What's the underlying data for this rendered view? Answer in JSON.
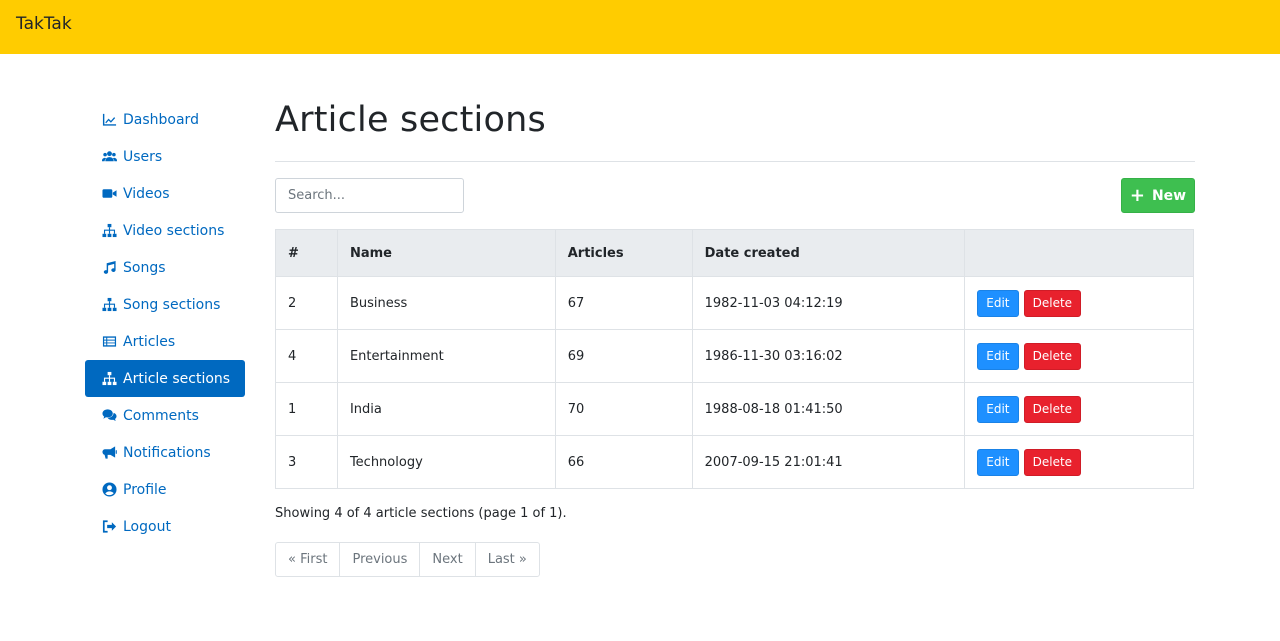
{
  "header": {
    "brand": "TakTak",
    "bg_color": "#ffcc00"
  },
  "sidebar": {
    "items": [
      {
        "label": "Dashboard",
        "icon": "chart-line-icon",
        "active": false
      },
      {
        "label": "Users",
        "icon": "users-icon",
        "active": false
      },
      {
        "label": "Videos",
        "icon": "video-icon",
        "active": false
      },
      {
        "label": "Video sections",
        "icon": "sitemap-icon",
        "active": false
      },
      {
        "label": "Songs",
        "icon": "music-icon",
        "active": false
      },
      {
        "label": "Song sections",
        "icon": "sitemap-icon",
        "active": false
      },
      {
        "label": "Articles",
        "icon": "list-icon",
        "active": false
      },
      {
        "label": "Article sections",
        "icon": "sitemap-icon",
        "active": true
      },
      {
        "label": "Comments",
        "icon": "comments-icon",
        "active": false
      },
      {
        "label": "Notifications",
        "icon": "bullhorn-icon",
        "active": false
      },
      {
        "label": "Profile",
        "icon": "user-circle-icon",
        "active": false
      },
      {
        "label": "Logout",
        "icon": "sign-out-icon",
        "active": false
      }
    ],
    "active_color": "#0069c0"
  },
  "main": {
    "title": "Article sections",
    "search": {
      "placeholder": "Search..."
    },
    "new_button": {
      "label": "New",
      "icon": "plus-icon",
      "color": "#3ebf50"
    },
    "table": {
      "columns": [
        "#",
        "Name",
        "Articles",
        "Date created",
        ""
      ],
      "rows": [
        {
          "id": "2",
          "name": "Business",
          "articles": "67",
          "date": "1982-11-03 04:12:19"
        },
        {
          "id": "4",
          "name": "Entertainment",
          "articles": "69",
          "date": "1986-11-30 03:16:02"
        },
        {
          "id": "1",
          "name": "India",
          "articles": "70",
          "date": "1988-08-18 01:41:50"
        },
        {
          "id": "3",
          "name": "Technology",
          "articles": "66",
          "date": "2007-09-15 21:01:41"
        }
      ],
      "edit_label": "Edit",
      "delete_label": "Delete",
      "edit_color": "#1e90ff",
      "delete_color": "#e8212d"
    },
    "summary": "Showing 4 of 4 article sections (page 1 of 1).",
    "pagination": [
      "« First",
      "Previous",
      "Next",
      "Last »"
    ]
  }
}
